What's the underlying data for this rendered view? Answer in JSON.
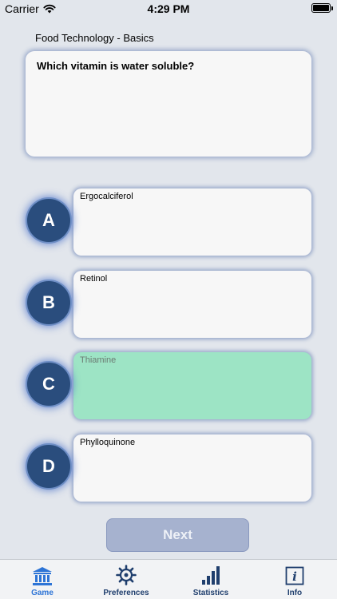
{
  "status_bar": {
    "carrier": "Carrier",
    "time": "4:29 PM"
  },
  "header": {
    "category": "Food Technology - Basics"
  },
  "question": {
    "text": "Which vitamin is water soluble?"
  },
  "answers": [
    {
      "letter": "A",
      "text": "Ergocalciferol"
    },
    {
      "letter": "B",
      "text": "Retinol"
    },
    {
      "letter": "C",
      "text": "Thiamine",
      "state": "correct"
    },
    {
      "letter": "D",
      "text": "Phylloquinone"
    }
  ],
  "next_button": {
    "label": "Next"
  },
  "tabs": [
    {
      "label": "Game",
      "icon": "bank-icon",
      "active": true
    },
    {
      "label": "Preferences",
      "icon": "gear-icon"
    },
    {
      "label": "Statistics",
      "icon": "bar-chart-icon"
    },
    {
      "label": "Info",
      "icon": "info-icon"
    }
  ],
  "colors": {
    "badge": "#2a4d7d",
    "correct_answer": "#9de4c5",
    "tab_active": "#2d74d6",
    "tab_inactive": "#1f3e6d"
  }
}
